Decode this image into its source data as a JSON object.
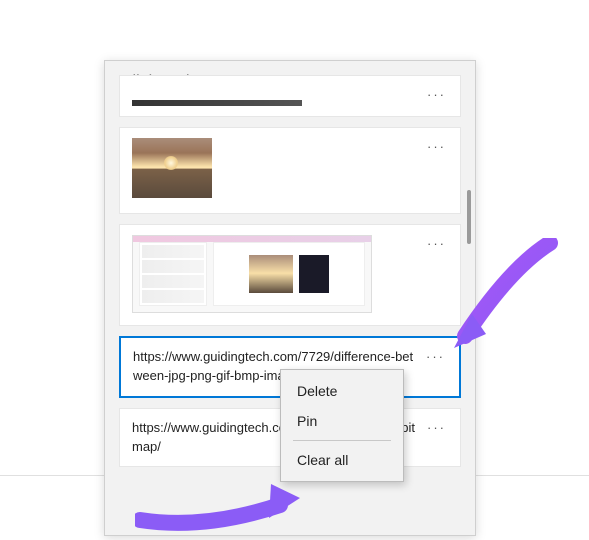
{
  "panel": {
    "title": "Clipboard"
  },
  "items": {
    "selectedText": "https://www.guidingtech.com/7729/difference-between-jpg-png-gif-bmp-image-formats/",
    "secondText": "https://www.guidingtech.com/difference-vector-bitmap/"
  },
  "icons": {
    "ellipsis": "···"
  },
  "menu": {
    "delete": "Delete",
    "pin": "Pin",
    "clearAll": "Clear all"
  }
}
